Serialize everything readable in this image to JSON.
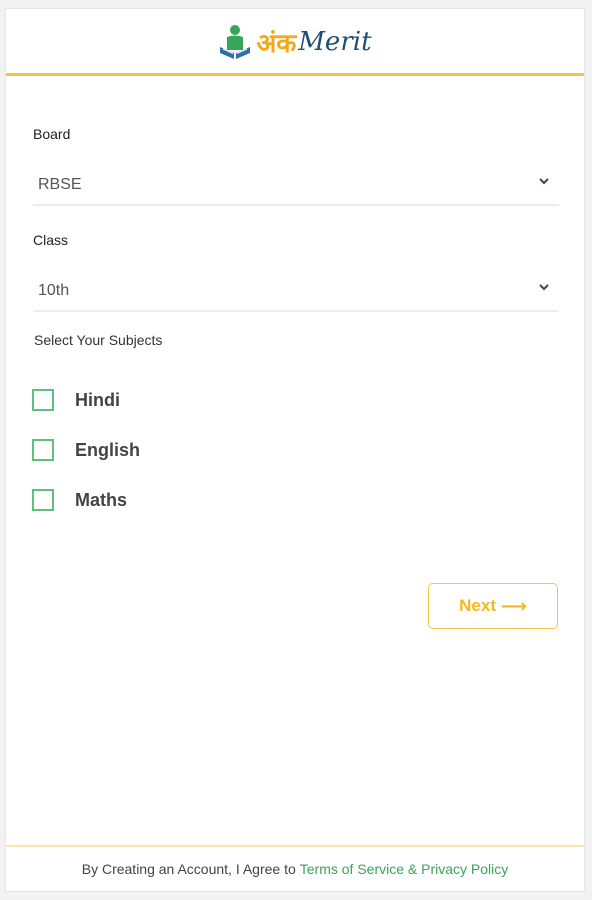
{
  "brand": {
    "logo_text_hi": "अंक",
    "logo_text_en": "Merit",
    "accent_color": "#f5c447",
    "green_color": "#5ec07d"
  },
  "form": {
    "board": {
      "label": "Board",
      "value": "RBSE"
    },
    "class": {
      "label": "Class",
      "value": "10th"
    },
    "subjects_label": "Select Your Subjects",
    "subjects": [
      {
        "label": "Hindi",
        "checked": false
      },
      {
        "label": "English",
        "checked": false
      },
      {
        "label": "Maths",
        "checked": false
      }
    ],
    "next_label": "Next",
    "next_arrow": "⟶"
  },
  "footer": {
    "text": "By Creating an Account, I Agree to",
    "link": "Terms of Service & Privacy Policy"
  }
}
